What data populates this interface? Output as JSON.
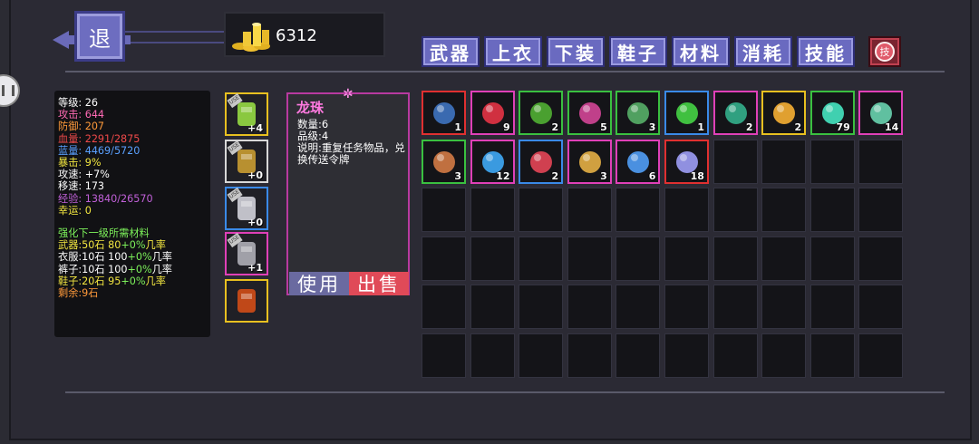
{
  "header": {
    "back_label": "退",
    "gold": "6312"
  },
  "tabs": [
    "武器",
    "上衣",
    "下装",
    "鞋子",
    "材料",
    "消耗",
    "技能"
  ],
  "skill_button_label": "技",
  "stats": [
    {
      "text": "等级: 26",
      "color": "w"
    },
    {
      "text": "攻击: 644",
      "color": "pk"
    },
    {
      "text": "防御: 207",
      "color": "o"
    },
    {
      "text": "血量: 2291/2875",
      "color": "r"
    },
    {
      "text": "蓝量: 4469/5720",
      "color": "b"
    },
    {
      "text": "暴击: 9%",
      "color": "y"
    },
    {
      "text": "攻速: +7%",
      "color": "w"
    },
    {
      "text": "移速: 173",
      "color": "w"
    },
    {
      "text": "经验: 13840/26570",
      "color": "p"
    },
    {
      "text": "幸运: 0",
      "color": "y"
    }
  ],
  "enhance": {
    "title": "强化下一级所需材料",
    "lines": [
      {
        "a": "武器:50石 80",
        "b": "+0%",
        "c": "几率",
        "color": "y"
      },
      {
        "a": "衣服:10石 100",
        "b": "+0%",
        "c": "几率",
        "color": "w"
      },
      {
        "a": "裤子:10石 100",
        "b": "+0%",
        "c": "几率",
        "color": "w"
      },
      {
        "a": "鞋子:20石 95",
        "b": "+0%",
        "c": "几率",
        "color": "y"
      }
    ],
    "remaining": "剩余:9石"
  },
  "equipment": [
    {
      "name": "weapon",
      "level": "+4",
      "border": "#e8c020",
      "icon": "#8ac840"
    },
    {
      "name": "top",
      "level": "+0",
      "border": "#d8d8d8",
      "icon": "#b89030"
    },
    {
      "name": "bottom",
      "level": "+0",
      "border": "#3a8ae8",
      "icon": "#c0c0c8"
    },
    {
      "name": "shoes",
      "level": "+1",
      "border": "#e040b8",
      "icon": "#a0a0a8"
    },
    {
      "name": "accessory",
      "level": "",
      "border": "#e8c020",
      "icon": "#c04818"
    }
  ],
  "detail": {
    "name": "龙珠",
    "qty": "数量:6",
    "grade": "品级:4",
    "desc": "说明:重复任务物品，兑换传送令牌",
    "use_label": "使用",
    "sell_label": "出售"
  },
  "inventory": [
    {
      "count": "1",
      "border": "#e03030",
      "icon": "#3a6ab0"
    },
    {
      "count": "9",
      "border": "#e040b8",
      "icon": "#d03040"
    },
    {
      "count": "2",
      "border": "#3ac040",
      "icon": "#4aa030"
    },
    {
      "count": "5",
      "border": "#3ac040",
      "icon": "#c0408a"
    },
    {
      "count": "3",
      "border": "#3ac040",
      "icon": "#50a060"
    },
    {
      "count": "1",
      "border": "#3a8ae8",
      "icon": "#40c040"
    },
    {
      "count": "2",
      "border": "#e040b8",
      "icon": "#30a080"
    },
    {
      "count": "2",
      "border": "#e8c020",
      "icon": "#e0a030"
    },
    {
      "count": "79",
      "border": "#3ac040",
      "icon": "#40d0b0"
    },
    {
      "count": "14",
      "border": "#e040b8",
      "icon": "#60c0a0"
    },
    {
      "count": "3",
      "border": "#3ac040",
      "icon": "#c07040"
    },
    {
      "count": "12",
      "border": "#e040b8",
      "icon": "#3a9ae0"
    },
    {
      "count": "2",
      "border": "#3a8ae8",
      "icon": "#d04050"
    },
    {
      "count": "3",
      "border": "#e040b8",
      "icon": "#d0a040"
    },
    {
      "count": "6",
      "border": "#e040b8",
      "icon": "#4a90e0"
    },
    {
      "count": "18",
      "border": "#e03030",
      "icon": "#9090e0"
    }
  ],
  "total_slots": 60
}
